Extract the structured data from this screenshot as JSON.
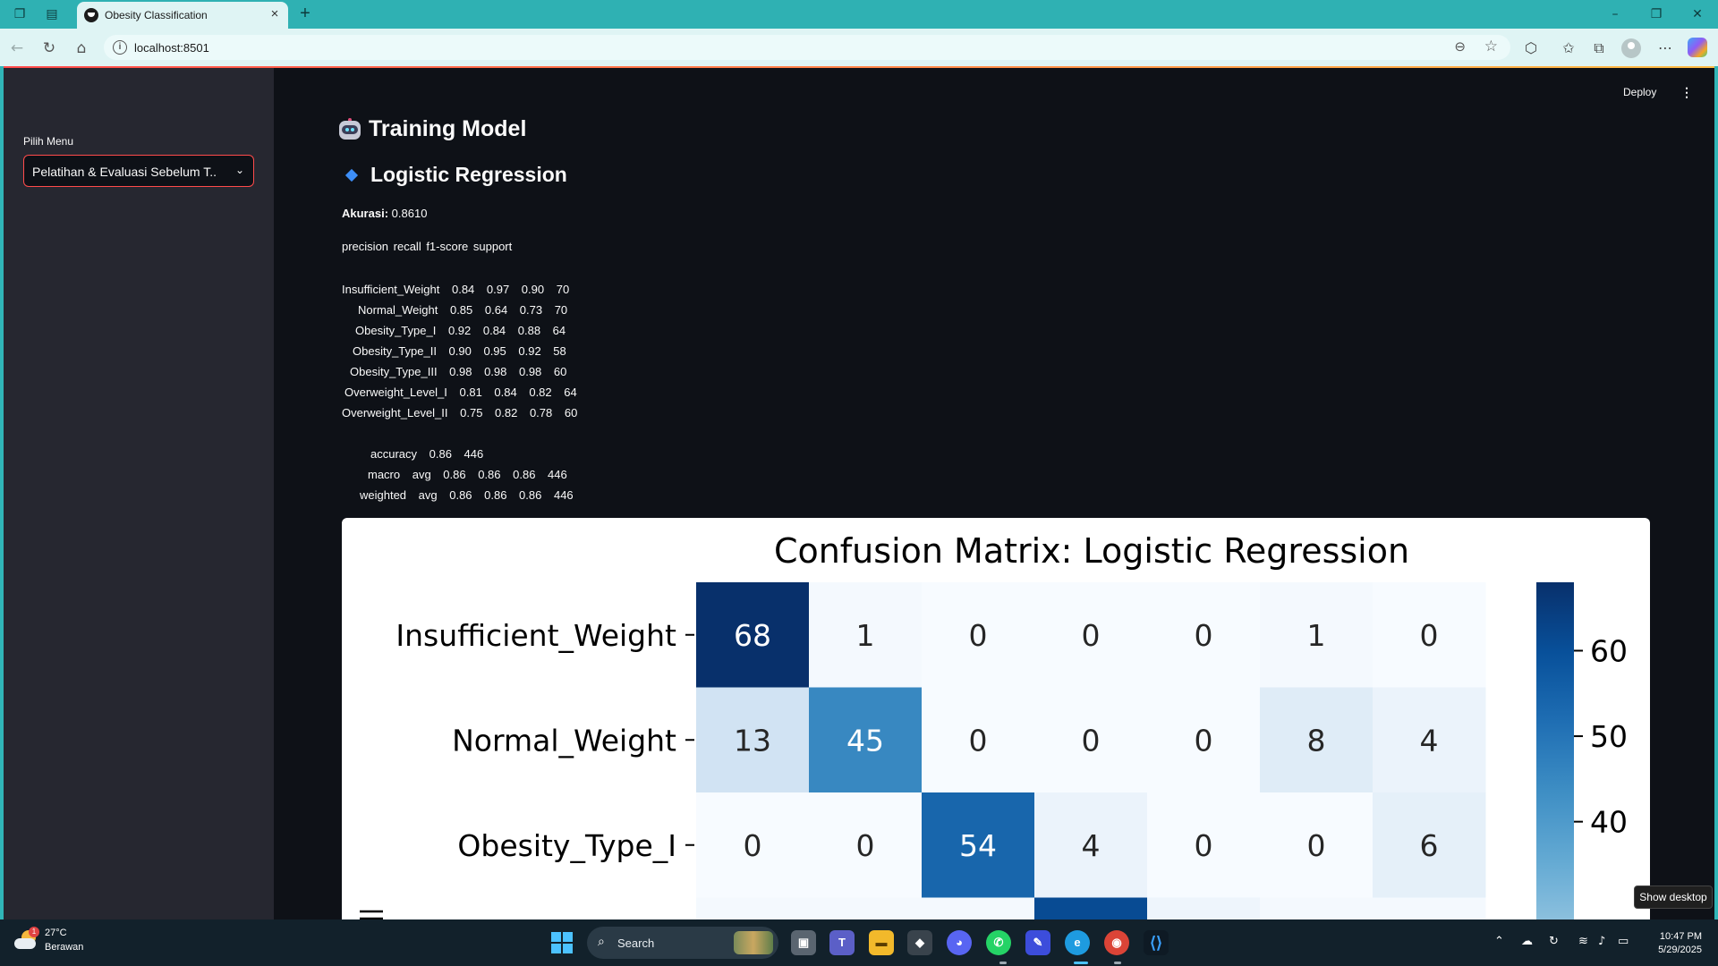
{
  "browser": {
    "tab_title": "Obesity Classification",
    "url": "localhost:8501"
  },
  "app": {
    "deploy_label": "Deploy",
    "sidebar": {
      "select_label": "Pilih Menu",
      "select_value": "Pelatihan & Evaluasi Sebelum T..."
    },
    "title": "Training Model",
    "subtitle": "Logistic Regression",
    "accuracy_label": "Akurasi:",
    "accuracy_value": "0.8610",
    "report_header": "precision    recall  f1-score   support",
    "report_rows": [
      "Insufficient_Weight      0.84      0.97      0.90        70",
      "Normal_Weight      0.85      0.64      0.73        70",
      "Obesity_Type_I      0.92      0.84      0.88        64",
      "Obesity_Type_II      0.90      0.95      0.92        58",
      "Obesity_Type_III      0.98      0.98      0.98        60",
      "Overweight_Level_I      0.81      0.84      0.82        64",
      "Overweight_Level_II      0.75      0.82      0.78        60"
    ],
    "report_summary": [
      "accuracy                          0.86       446",
      "macro avg      0.86      0.86      0.86       446",
      "weighted avg      0.86      0.86      0.86       446"
    ]
  },
  "chart_data": {
    "type": "heatmap",
    "title": "Confusion Matrix: Logistic Regression",
    "rows": [
      "Insufficient_Weight",
      "Normal_Weight",
      "Obesity_Type_I"
    ],
    "matrix": [
      [
        68,
        1,
        0,
        0,
        0,
        1,
        0
      ],
      [
        13,
        45,
        0,
        0,
        0,
        8,
        4
      ],
      [
        0,
        0,
        54,
        4,
        0,
        0,
        6
      ]
    ],
    "colorbar_ticks": [
      60,
      50,
      40
    ],
    "colormap": "Blues",
    "vmin": 0,
    "vmax": 68
  },
  "taskbar": {
    "temperature": "27°C",
    "condition": "Berawan",
    "weather_badge": "1",
    "search_placeholder": "Search",
    "time": "10:47 PM",
    "date": "5/29/2025",
    "show_desktop": "Show desktop"
  },
  "icons": [
    "workspaces-icon",
    "tab-actions-icon",
    "close-icon",
    "new-tab-icon",
    "back-icon",
    "refresh-icon",
    "home-icon",
    "info-icon",
    "zoom-icon",
    "favorite-star-icon",
    "extensions-icon",
    "favorites-icon",
    "collections-icon",
    "profile-icon",
    "more-icon",
    "copilot-icon"
  ]
}
